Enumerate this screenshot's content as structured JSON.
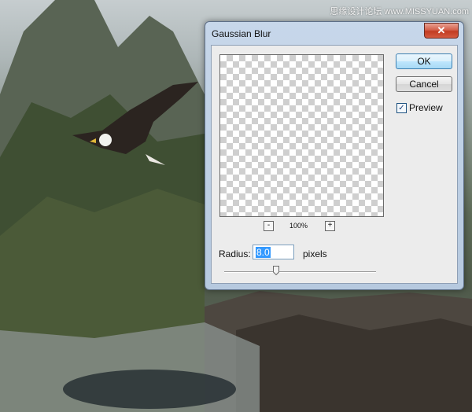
{
  "watermark": "思缘设计论坛 www.MISSYUAN.com",
  "dialog": {
    "title": "Gaussian Blur",
    "close_glyph": "✕",
    "buttons": {
      "ok_label": "OK",
      "cancel_label": "Cancel"
    },
    "preview": {
      "label": "Preview",
      "checked": true,
      "check_glyph": "✓"
    },
    "zoom": {
      "out_label": "-",
      "in_label": "+",
      "level": "100%"
    },
    "radius": {
      "label": "Radius:",
      "value": "8.0",
      "units": "pixels"
    }
  },
  "icons": {
    "close": "close-icon",
    "checkmark": "checkmark-icon",
    "slider_thumb": "slider-thumb-icon"
  },
  "colors": {
    "titlebar": "#c7d7ea",
    "close_button": "#c23c22",
    "selection": "#3399ff",
    "ok_button_border": "#3c7fb1"
  }
}
